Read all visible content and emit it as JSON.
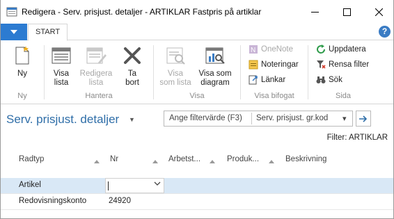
{
  "window": {
    "title": "Redigera - Serv. prisjust. detaljer - ARTIKLAR Fastpris på artiklar"
  },
  "ribbon": {
    "tab": "START",
    "groups": {
      "ny": {
        "label": "Ny",
        "buttons": {
          "ny": "Ny"
        }
      },
      "hantera": {
        "label": "Hantera",
        "buttons": {
          "visa_lista": "Visa\nlista",
          "redigera_lista": "Redigera\nlista",
          "ta_bort": "Ta\nbort"
        }
      },
      "visa": {
        "label": "Visa",
        "buttons": {
          "visa_som_lista": "Visa\nsom lista",
          "visa_som_diagram": "Visa som\ndiagram"
        }
      },
      "visa_bifogat": {
        "label": "Visa bifogat",
        "buttons": {
          "onenote": "OneNote",
          "noteringar": "Noteringar",
          "lankar": "Länkar"
        }
      },
      "sida": {
        "label": "Sida",
        "buttons": {
          "uppdatera": "Uppdatera",
          "rensa_filter": "Rensa filter",
          "sok": "Sök"
        }
      }
    }
  },
  "page": {
    "title": "Serv. prisjust. detaljer",
    "filter": {
      "placeholder": "Ange filtervärde (F3)",
      "field": "Serv. prisjust. gr.kod"
    },
    "filter_status": "Filter: ARTIKLAR"
  },
  "table": {
    "columns": [
      "Radtyp",
      "Nr",
      "Arbetst...",
      "Produk...",
      "Beskrivning"
    ],
    "rows": [
      {
        "radtyp": "Artikel",
        "nr": ""
      },
      {
        "radtyp": "Redovisningskonto",
        "nr": "24920"
      }
    ]
  },
  "colors": {
    "accent": "#2c7bd1",
    "title_blue": "#2f6ea8",
    "selected_row": "#d9e8f6"
  }
}
